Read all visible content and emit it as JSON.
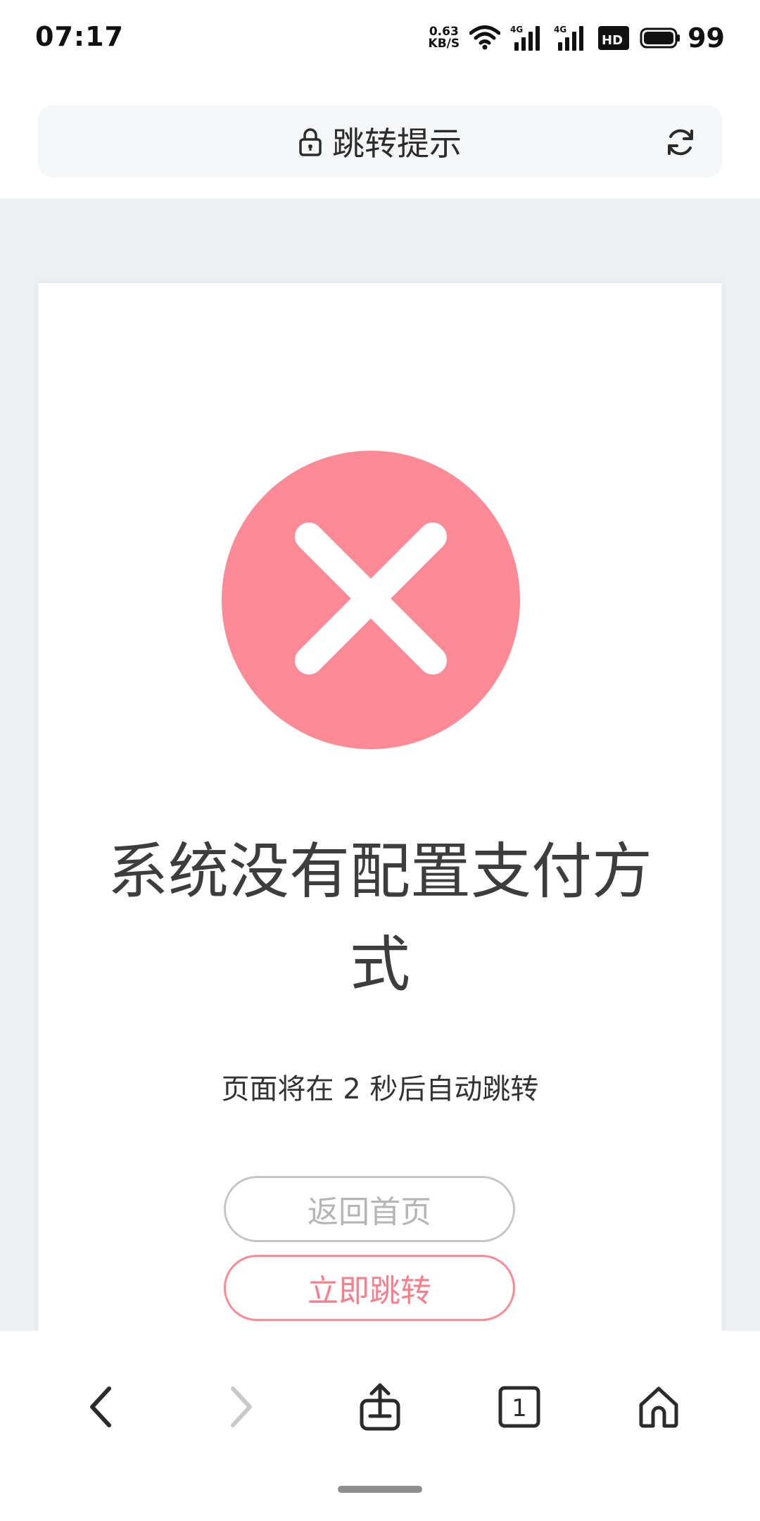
{
  "status_bar": {
    "time": "07:17",
    "net_speed_value": "0.63",
    "net_speed_unit": "KB/S",
    "signal_label_1": "4G",
    "signal_label_2": "4G",
    "hd_label": "HD",
    "battery": "99"
  },
  "browser": {
    "title": "跳转提示",
    "icons": {
      "lock": "lock-icon",
      "reload": "reload-icon"
    }
  },
  "error_page": {
    "title": "系统没有配置支付方式",
    "countdown_text": "页面将在 2 秒后自动跳转",
    "home_button": "返回首页",
    "jump_button": "立即跳转",
    "icon": "error-x-circle-icon",
    "colors": {
      "error_icon": "#fd8a94",
      "jump_button": "#f7808c",
      "home_button": "#b5b5b5"
    }
  },
  "bottom_nav": {
    "tab_count": "1",
    "icons": [
      "back-icon",
      "forward-icon",
      "share-icon",
      "tabs-icon",
      "home-icon"
    ]
  }
}
